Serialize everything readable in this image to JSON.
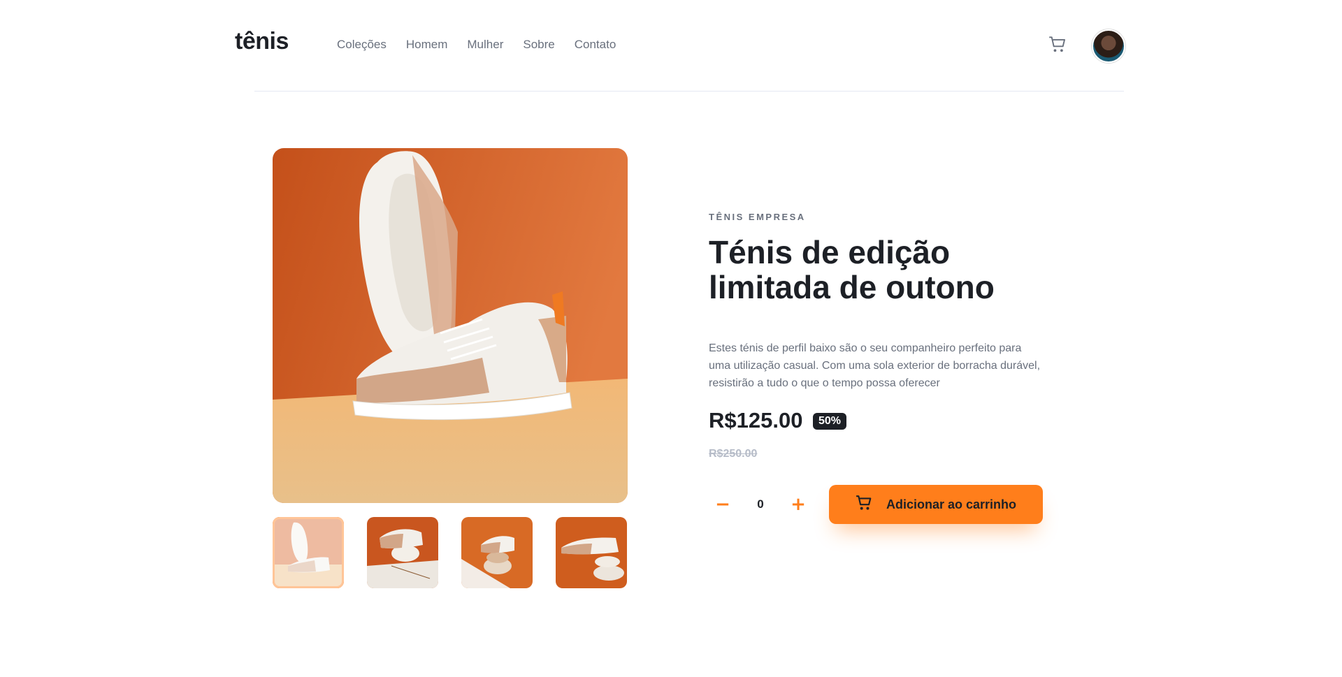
{
  "header": {
    "logo": "tênis",
    "nav": [
      "Coleções",
      "Homem",
      "Mulher",
      "Sobre",
      "Contato"
    ]
  },
  "product": {
    "brand": "TÊNIS EMPRESA",
    "title": "Ténis de edição limitada de outono",
    "description": "Estes ténis de perfil baixo são o seu companheiro perfeito para uma utilização casual. Com uma sola exterior de borracha durável, resistirão a tudo o que o tempo possa oferecer",
    "price": "R$125.00",
    "discount": "50%",
    "old_price": "R$250.00",
    "quantity": "0",
    "minus": "−",
    "plus": "+",
    "add_to_cart": "Adicionar ao carrinho"
  },
  "colors": {
    "accent": "#ff7e1b",
    "dark": "#1d2026",
    "muted": "#69707d"
  },
  "icons": [
    "cart-icon",
    "minus-icon",
    "plus-icon"
  ]
}
